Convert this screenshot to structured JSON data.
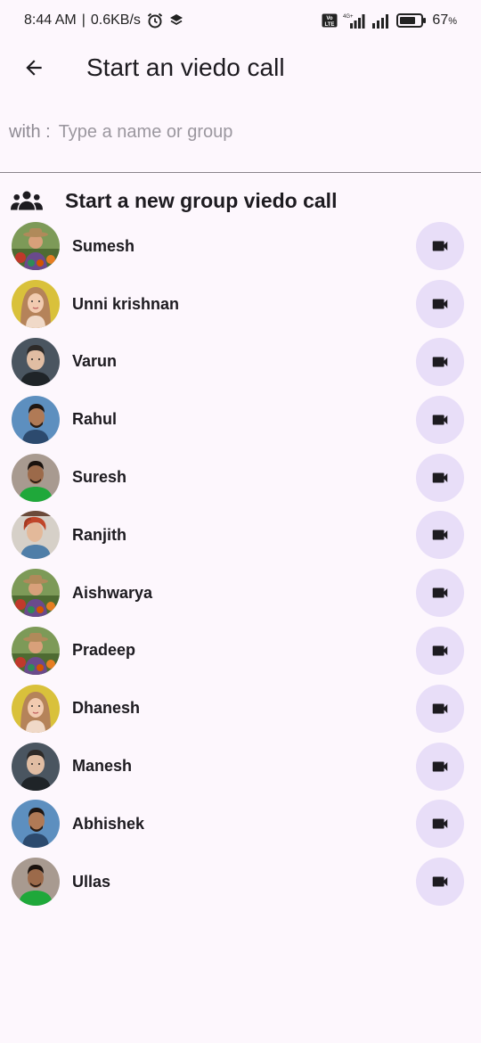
{
  "status_bar": {
    "time": "8:44 AM",
    "separator": "|",
    "speed": "0.6KB/s",
    "battery_percent": "67",
    "battery_unit": "%",
    "volte": "Vo LTE",
    "network": "4G+",
    "icons": [
      "alarm-icon",
      "layers-icon",
      "volte-icon",
      "signal-icon",
      "signal-icon",
      "battery-icon"
    ]
  },
  "app_bar": {
    "title": "Start an viedo call",
    "back_icon": "arrow-left-icon"
  },
  "search": {
    "label": "with :",
    "placeholder": "Type a name or group",
    "value": ""
  },
  "group_call": {
    "label": "Start a new group viedo call",
    "icon": "group-icon"
  },
  "contacts": [
    {
      "name": "Sumesh",
      "avatar": "farmer"
    },
    {
      "name": "Unni krishnan",
      "avatar": "woman"
    },
    {
      "name": "Varun",
      "avatar": "man-dark"
    },
    {
      "name": "Rahul",
      "avatar": "man-blue"
    },
    {
      "name": "Suresh",
      "avatar": "man-green"
    },
    {
      "name": "Ranjith",
      "avatar": "man-redhair"
    },
    {
      "name": "Aishwarya",
      "avatar": "farmer"
    },
    {
      "name": "Pradeep",
      "avatar": "farmer"
    },
    {
      "name": "Dhanesh",
      "avatar": "woman"
    },
    {
      "name": "Manesh",
      "avatar": "man-dark"
    },
    {
      "name": "Abhishek",
      "avatar": "man-blue"
    },
    {
      "name": "Ullas",
      "avatar": "man-green"
    }
  ],
  "call_icon": "videocam-icon",
  "colors": {
    "background": "#fdf7fd",
    "call_button_bg": "#e8def8",
    "divider": "#8a858c",
    "placeholder": "#9b979f"
  }
}
